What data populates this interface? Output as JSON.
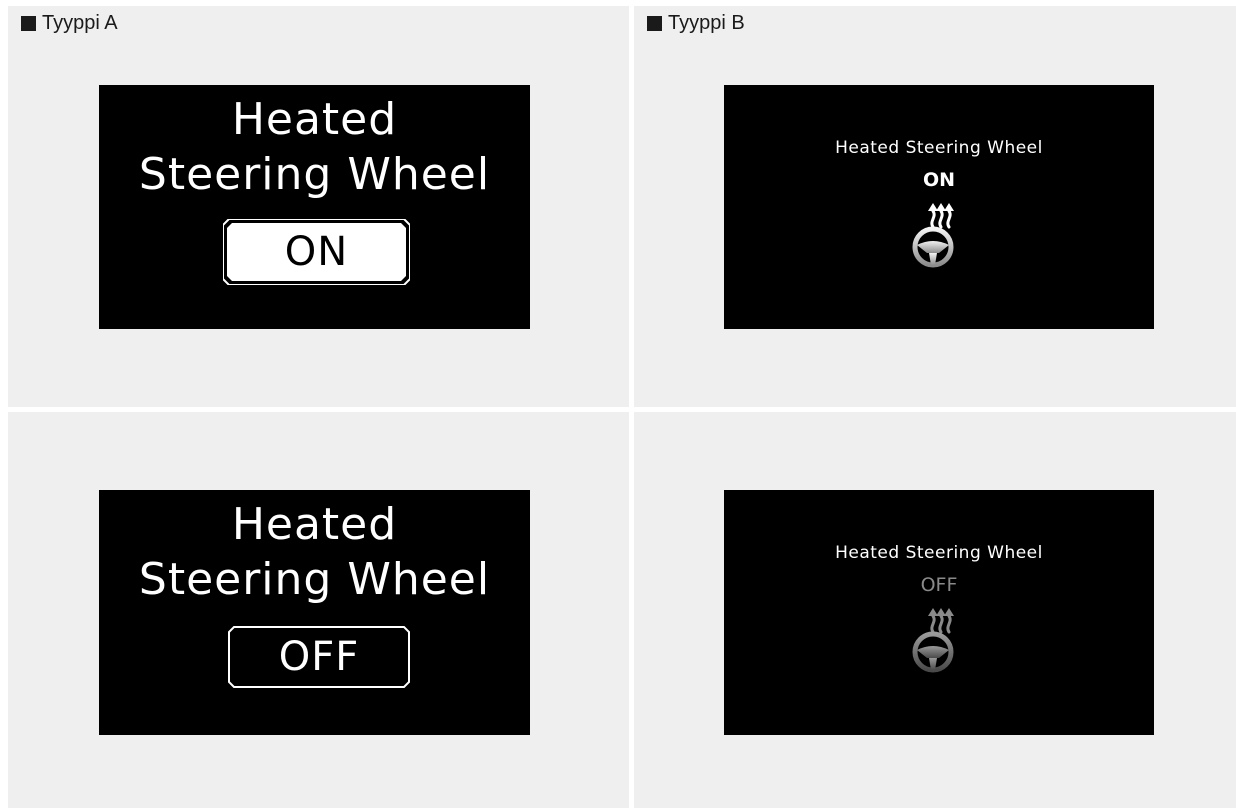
{
  "type_a": {
    "label": "Tyyppi A",
    "title_line1": "Heated",
    "title_line2": "Steering Wheel",
    "state_on": "ON",
    "state_off": "OFF"
  },
  "type_b": {
    "label": "Tyyppi B",
    "title": "Heated Steering Wheel",
    "state_on": "ON",
    "state_off": "OFF",
    "icon": "heated-steering-wheel-icon"
  },
  "colors": {
    "panel_bg": "#efefef",
    "screen_bg": "#000000",
    "on_text": "#ffffff",
    "off_text": "#8a8a8a"
  }
}
